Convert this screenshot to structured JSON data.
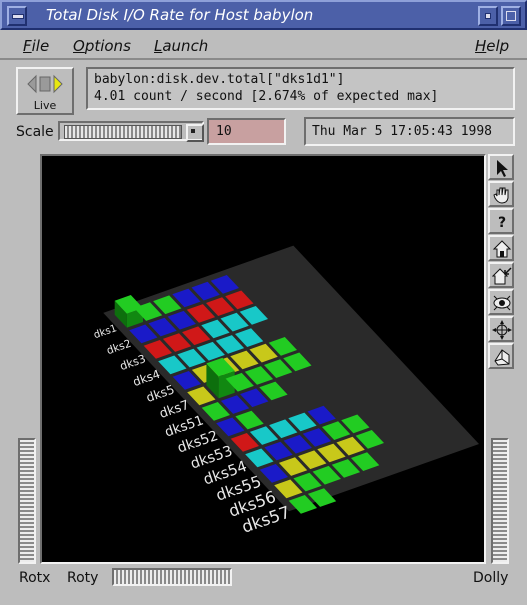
{
  "window": {
    "title": "Total Disk I/O Rate for Host babylon"
  },
  "menubar": {
    "file": "File",
    "options": "Options",
    "launch": "Launch",
    "help": "Help"
  },
  "live_button": {
    "label": "Live",
    "icon": "vcr-play-icon"
  },
  "info": {
    "line1": "babylon:disk.dev.total[\"dks1d1\"]",
    "line2": "4.01 count / second [2.674% of expected max]"
  },
  "scale": {
    "label": "Scale",
    "value": "10"
  },
  "datetime": "Thu Mar  5 17:05:43 1998",
  "scene": {
    "row_labels": [
      "dks1",
      "dks2",
      "dks3",
      "dks4",
      "dks5",
      "dks7",
      "dks51",
      "dks52",
      "dks53",
      "dks54",
      "dks55",
      "dks56",
      "dks57"
    ],
    "colors": {
      "green": "#22cc22",
      "blue": "#1a1ac8",
      "red": "#d01818",
      "cyan": "#18c8c8",
      "yellow": "#c8c81a",
      "platform": "#2a2a2a"
    }
  },
  "tools": [
    "pointer-icon",
    "hand-icon",
    "help-icon",
    "home-icon",
    "set-home-icon",
    "view-all-icon",
    "seek-icon",
    "perspective-icon"
  ],
  "tool_glyphs": {
    "help": "?"
  },
  "bottom": {
    "rotx": "Rotx",
    "roty": "Roty",
    "dolly": "Dolly"
  }
}
